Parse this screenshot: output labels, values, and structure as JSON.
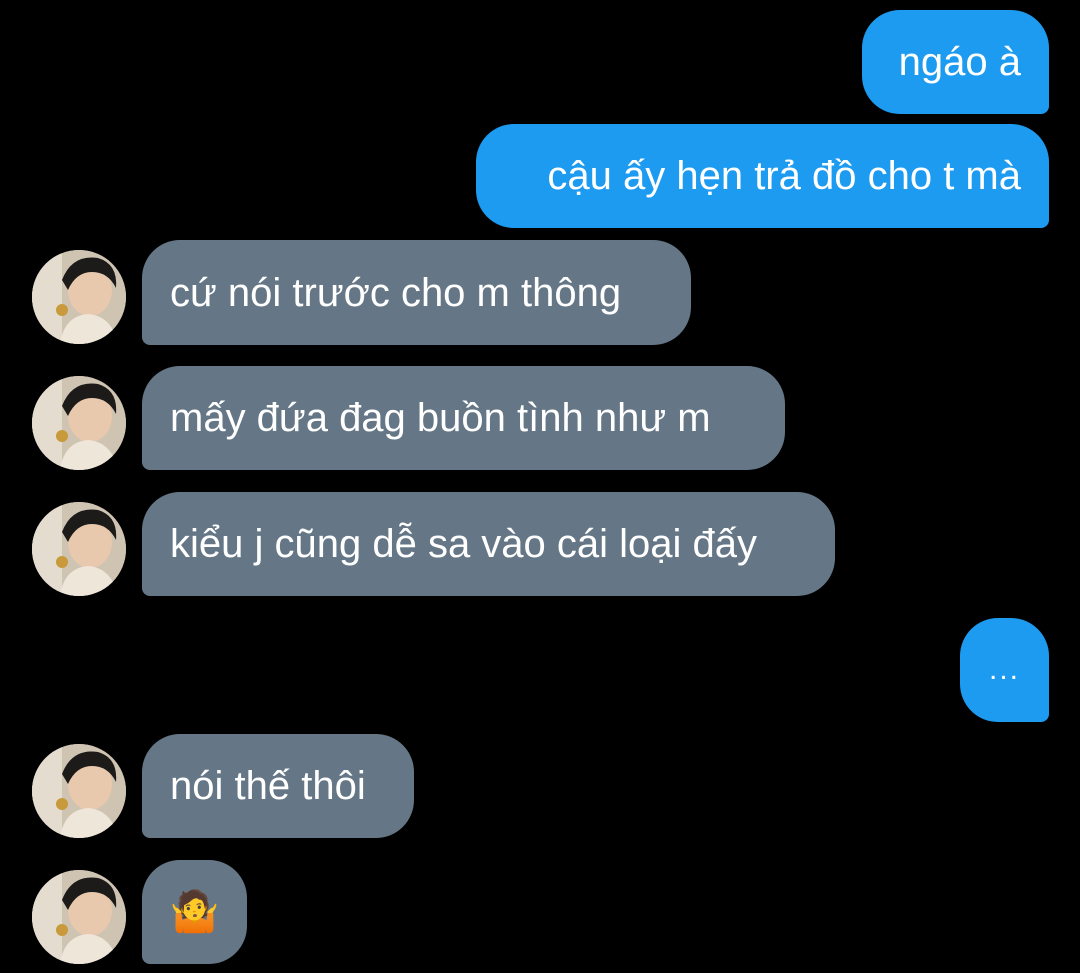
{
  "colors": {
    "background": "#000000",
    "outgoing_bubble": "#1d9bf0",
    "incoming_bubble": "#657786",
    "text": "#ffffff"
  },
  "messages": [
    {
      "direction": "outgoing",
      "text": "ngáo à"
    },
    {
      "direction": "outgoing",
      "text": "cậu ấy hẹn trả đồ cho t mà"
    },
    {
      "direction": "incoming",
      "text": "cứ nói trước cho m thông"
    },
    {
      "direction": "incoming",
      "text": "mấy đứa đag buồn tình như m"
    },
    {
      "direction": "incoming",
      "text": "kiểu j cũng dễ sa vào cái loại đấy"
    },
    {
      "direction": "outgoing",
      "text": "..."
    },
    {
      "direction": "incoming",
      "text": "nói thế thôi"
    },
    {
      "direction": "incoming",
      "text": "🤷"
    }
  ],
  "avatar_icon": "user-avatar-photo"
}
